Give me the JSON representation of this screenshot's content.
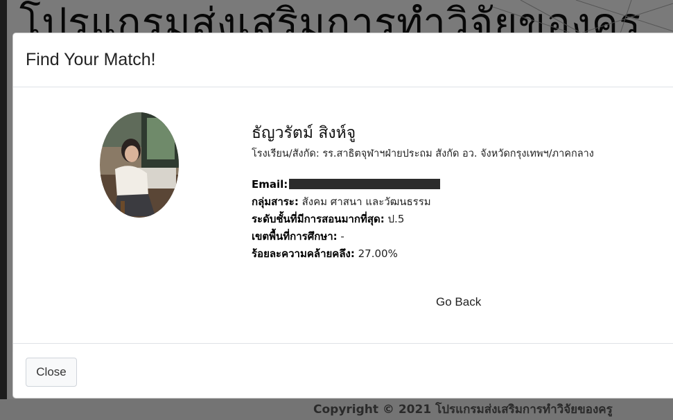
{
  "background": {
    "title": "โปรแกรมส่งเสริมการทำวิจัยของครู",
    "footer": "Copyright © 2021 โปรแกรมส่งเสริมการทำวิจัยของครู"
  },
  "modal": {
    "title": "Find Your Match!",
    "profile": {
      "name": "ธัญวรัตม์ สิงห์จู",
      "affiliation": "โรงเรียน/สังกัด: รร.สาธิตจุฬาฯฝ่ายประถม สังกัด อว. จังหวัดกรุงเทพฯ/ภาคกลาง",
      "email_label": "Email:",
      "subject_label": "กลุ่มสาระ:",
      "subject_value": "สังคม ศาสนา และวัฒนธรรม",
      "level_label": "ระดับชั้นที่มีการสอนมากที่สุด:",
      "level_value": "ป.5",
      "area_label": "เขตพื้นที่การศึกษา:",
      "area_value": "-",
      "similarity_label": "ร้อยละความคล้ายคลึง:",
      "similarity_value": "27.00%"
    },
    "go_back_label": "Go Back",
    "close_label": "Close"
  }
}
